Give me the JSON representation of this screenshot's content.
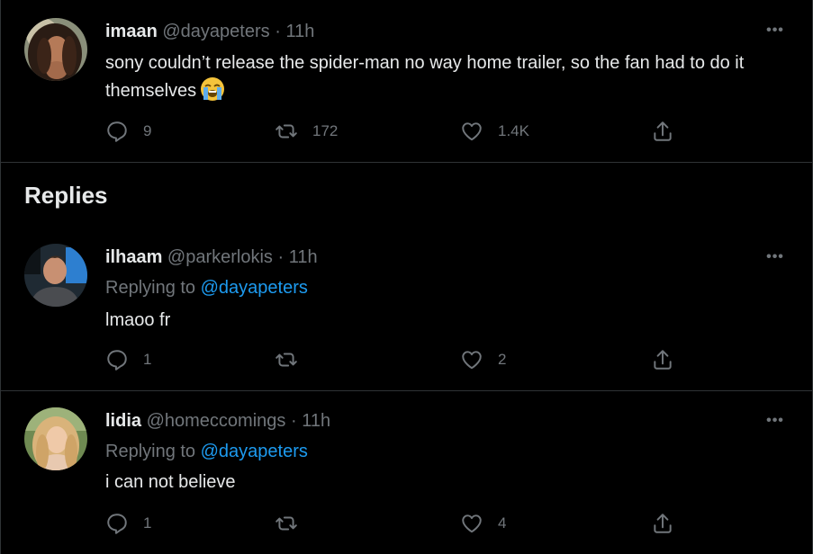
{
  "main_tweet": {
    "name": "imaan",
    "handle": "@dayapeters",
    "separator": "·",
    "time": "11h",
    "text": "sony couldn’t release the spider-man no way home trailer, so the fan had to do it themselves",
    "emoji_icon": "loudly-crying-face-emoji",
    "more_label": "•••",
    "reply_count": "9",
    "retweet_count": "172",
    "like_count": "1.4K"
  },
  "replies_heading": "Replies",
  "replies": [
    {
      "name": "ilhaam",
      "handle": "@parkerlokis",
      "separator": "·",
      "time": "11h",
      "replying_to_prefix": "Replying to",
      "replying_to_handle": "@dayapeters",
      "text": "lmaoo fr",
      "more_label": "•••",
      "reply_count": "1",
      "retweet_count": "",
      "like_count": "2"
    },
    {
      "name": "lidia",
      "handle": "@homeccomings",
      "separator": "·",
      "time": "11h",
      "replying_to_prefix": "Replying to",
      "replying_to_handle": "@dayapeters",
      "text": "i can not believe",
      "more_label": "•••",
      "reply_count": "1",
      "retweet_count": "",
      "like_count": "4"
    }
  ],
  "colors": {
    "background": "#000000",
    "divider": "#2f3336",
    "primary_text": "#e7e9ea",
    "secondary_text": "#71767b",
    "link": "#1d9bf0"
  }
}
